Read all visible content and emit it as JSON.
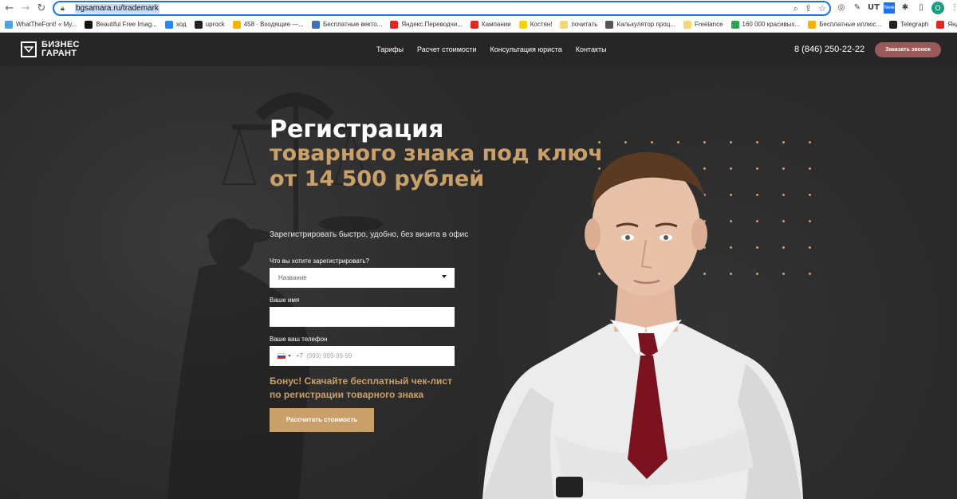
{
  "browser": {
    "url": "bgsamara.ru/trademark",
    "profile_initial": "O",
    "bookmarks": [
      {
        "label": "WhatTheFont! « My...",
        "color": "#4aa3df"
      },
      {
        "label": "Beautiful Free Imag...",
        "color": "#111111"
      },
      {
        "label": "ход",
        "color": "#2787f5"
      },
      {
        "label": "uprock",
        "color": "#222222"
      },
      {
        "label": "458 · Входящие —...",
        "color": "#f5b400"
      },
      {
        "label": "Бесплатные векто...",
        "color": "#3b6fb6"
      },
      {
        "label": "Яндекс.Переводчи...",
        "color": "#e52620"
      },
      {
        "label": "Кампании",
        "color": "#e52620"
      },
      {
        "label": "Костян!",
        "color": "#f5d400"
      },
      {
        "label": "почитать",
        "color": "#f7d774"
      },
      {
        "label": "Калькулятор проц...",
        "color": "#555555"
      },
      {
        "label": "Freelance",
        "color": "#f7d774"
      },
      {
        "label": "160 000 красивых...",
        "color": "#2ea44f"
      },
      {
        "label": "Бесплатные иллюс...",
        "color": "#f5b400"
      },
      {
        "label": "Telegraph",
        "color": "#222222"
      },
      {
        "label": "Яндекс",
        "color": "#e52620"
      }
    ]
  },
  "header": {
    "logo_line1": "БИЗНЕС",
    "logo_line2": "ГАРАНТ",
    "menu": [
      "Тарифы",
      "Расчет стоимости",
      "Консультация юриста",
      "Контакты"
    ],
    "phone": "8 (846) 250-22-22",
    "order_button": "Заказать звонок"
  },
  "hero": {
    "title_line1": "Регистрация",
    "title_line2": "товарного знака под ключ",
    "title_line3": "от 14 500 рублей",
    "subtitle": "Зарегистрировать быстро, удобно, без визита в офис"
  },
  "form": {
    "what_label": "Что вы хотите зарегистрировать?",
    "what_value": "Название",
    "name_label": "Ваше имя",
    "name_value": "",
    "phone_label": "Ваше ваш телефон",
    "phone_code": "+7",
    "phone_placeholder": "(999) 999-99-99",
    "bonus_line1": "Бонус! Скачайте бесплатный чек-лист",
    "bonus_line2": "по регистрации товарного знака",
    "submit": "Рассчитать стоимость"
  },
  "colors": {
    "accent_gold": "#c9a06a",
    "order_button": "#9a5a5a",
    "url_focus": "#1a73e8"
  }
}
